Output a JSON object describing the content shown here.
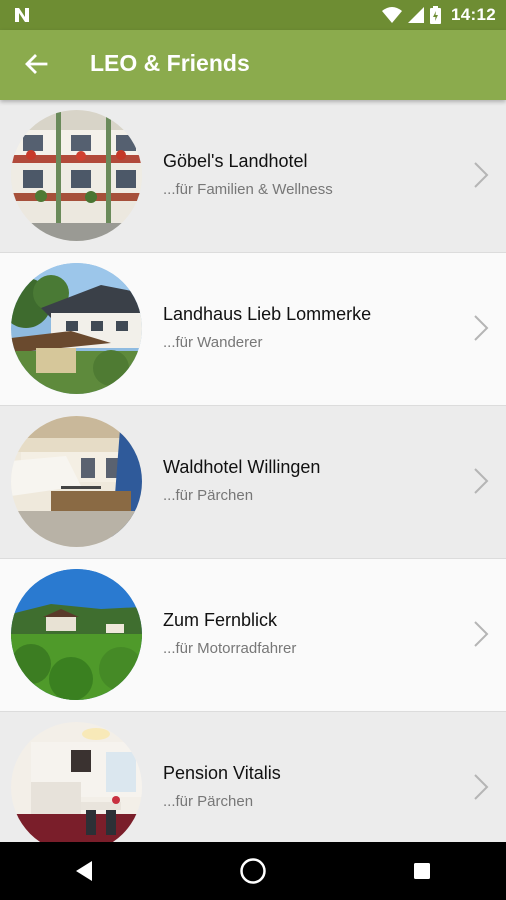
{
  "status_bar": {
    "time": "14:12",
    "icons": [
      "n-notification-icon",
      "wifi-icon",
      "signal-icon",
      "battery-icon"
    ]
  },
  "app_bar": {
    "title": "LEO & Friends",
    "back_icon": "arrow-back-icon",
    "color": "#8bab4d",
    "status_color": "#6e8d33"
  },
  "hotels": [
    {
      "name": "Göbel's Landhotel",
      "subtitle": "...für Familien & Wellness"
    },
    {
      "name": "Landhaus Lieb Lommerke",
      "subtitle": "...für Wanderer"
    },
    {
      "name": "Waldhotel Willingen",
      "subtitle": "...für Pärchen"
    },
    {
      "name": "Zum Fernblick",
      "subtitle": "...für Motorradfahrer"
    },
    {
      "name": "Pension Vitalis",
      "subtitle": "...für Pärchen"
    }
  ],
  "nav_bar": {
    "buttons": [
      "back-triangle-icon",
      "home-circle-icon",
      "recents-square-icon"
    ]
  }
}
